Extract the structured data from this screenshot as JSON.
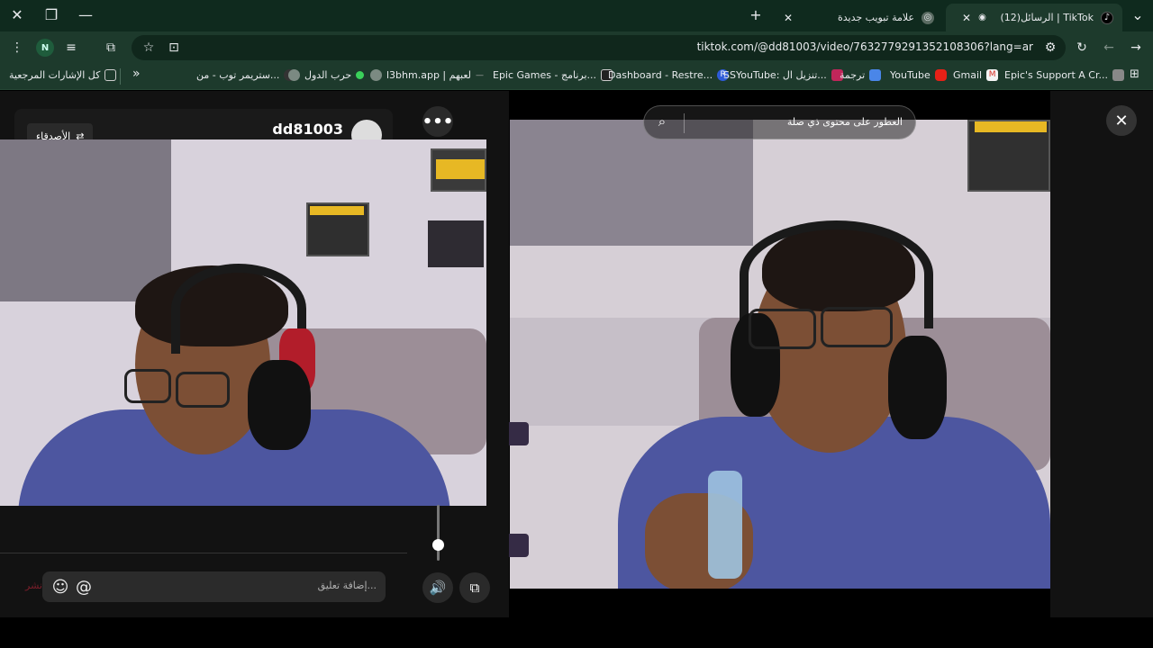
{
  "tabs": [
    {
      "title": "(12)الرسائل | TikTok",
      "active": true
    },
    {
      "title": "علامة تبويب جديدة",
      "active": false
    }
  ],
  "toolbar": {
    "url": "tiktok.com/@dd81003/video/7632779291352108306?lang=ar",
    "profile_initial": "N"
  },
  "bookmarks": {
    "all_bookmarks": "كل الإشارات المرجعية",
    "items": [
      {
        "label": "Epic's Support A Cr...",
        "icon": "epic-support-icon"
      },
      {
        "label": "Gmail",
        "icon": "gmail-icon"
      },
      {
        "label": "YouTube",
        "icon": "youtube-icon"
      },
      {
        "label": "ترجمة",
        "icon": "translate-icon"
      },
      {
        "label": "SSYouTube: تنزيل ال...",
        "icon": "ssyoutube-icon"
      },
      {
        "label": "Dashboard - Restre...",
        "icon": "restream-icon"
      },
      {
        "label": "Epic Games - برنامج...",
        "icon": "epic-games-icon"
      },
      {
        "label": "l3bhm.app | لعبهم",
        "icon": "l3bhm-icon"
      },
      {
        "label": "حرب الدول",
        "icon": "globe-icon"
      },
      {
        "label": "ستريمر توب - من...",
        "icon": "streamer-icon"
      }
    ],
    "overflow": "»"
  },
  "chat": {
    "username": "dd81003",
    "friends_label": "الأصدقاء",
    "comment_placeholder": "إضافة تعليق...",
    "send_label": "نشر"
  },
  "viewer": {
    "search_text": "العطور على محتوى ذي صلة",
    "close_label": "✕"
  },
  "colors": {
    "tabstrip": "#0f2a1e",
    "toolbar": "#1d3a2c",
    "panel": "#121212"
  }
}
